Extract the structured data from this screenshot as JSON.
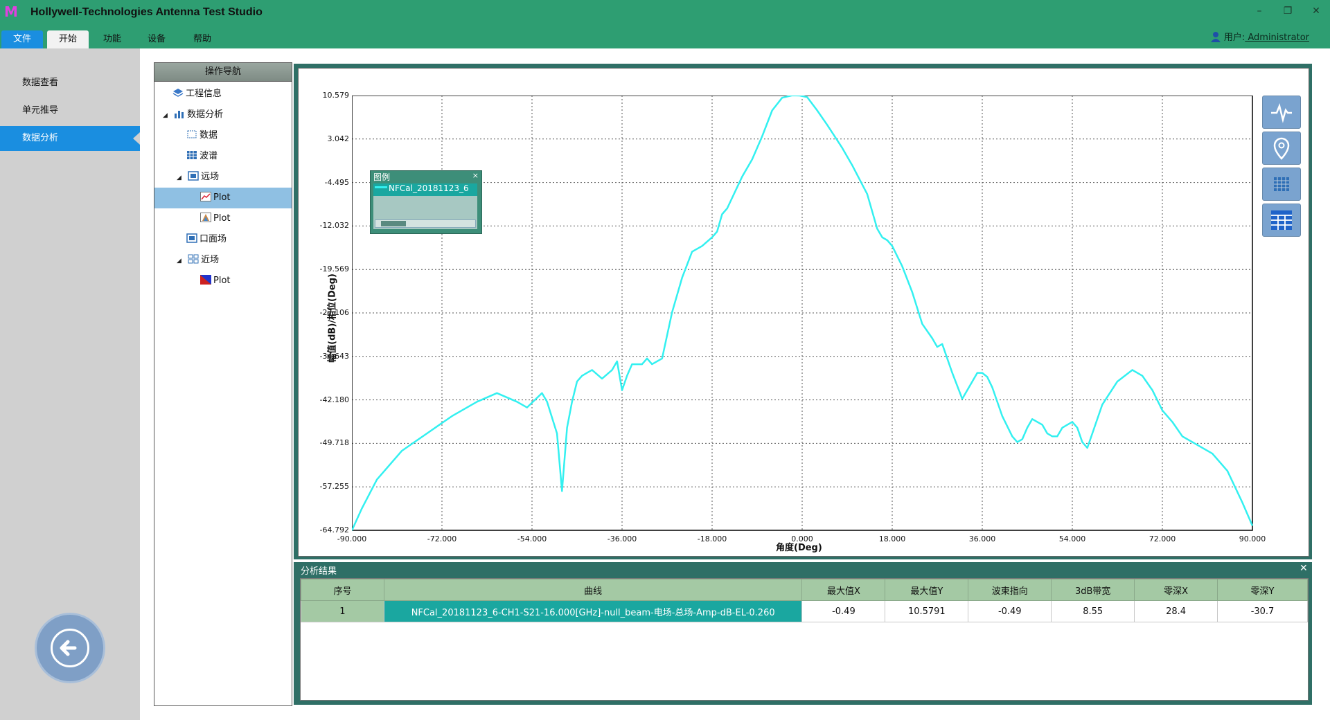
{
  "app": {
    "title": "Hollywell-Technologies Antenna Test Studio",
    "logo_letter": "M"
  },
  "window_controls": {
    "minimize": "–",
    "restore": "❐",
    "close": "✕"
  },
  "menu": {
    "file": "文件",
    "start": "开始",
    "function": "功能",
    "device": "设备",
    "help": "帮助"
  },
  "user": {
    "label": "用户:",
    "name": " Administrator"
  },
  "sidebar": {
    "items": [
      "数据查看",
      "单元推导",
      "数据分析"
    ]
  },
  "nav": {
    "header": "操作导航",
    "nodes": [
      {
        "label": "工程信息"
      },
      {
        "label": "数据分析"
      },
      {
        "label": "数据"
      },
      {
        "label": "波谱"
      },
      {
        "label": "远场"
      },
      {
        "label": "Plot"
      },
      {
        "label": "Plot"
      },
      {
        "label": "口面场"
      },
      {
        "label": "近场"
      },
      {
        "label": "Plot"
      }
    ]
  },
  "legend": {
    "title": "图例",
    "close": "×",
    "entry": "NFCal_20181123_6"
  },
  "chart_data": {
    "type": "line",
    "xlabel": "角度(Deg)",
    "ylabel": "幅值(dB)/相位(Deg)",
    "xlim": [
      -90,
      90
    ],
    "ylim": [
      -64.792,
      10.579
    ],
    "x_ticks": [
      "-90.000",
      "-72.000",
      "-54.000",
      "-36.000",
      "-18.000",
      "0.000",
      "18.000",
      "36.000",
      "54.000",
      "72.000",
      "90.000"
    ],
    "y_ticks": [
      "10.579",
      "3.042",
      "-4.495",
      "-12.032",
      "-19.569",
      "-27.106",
      "-34.643",
      "-42.180",
      "-49.718",
      "-57.255",
      "-64.792"
    ],
    "grid": true,
    "series": [
      {
        "name": "NFCal_20181123_6",
        "color": "#33f0f0",
        "x": [
          -90,
          -88,
          -85,
          -80,
          -75,
          -70,
          -65,
          -61,
          -57,
          -55,
          -52,
          -51,
          -49,
          -48,
          -47,
          -46,
          -45,
          -44,
          -43,
          -42,
          -40,
          -38,
          -37,
          -36,
          -35,
          -34,
          -32,
          -31,
          -30,
          -28,
          -26,
          -24,
          -22,
          -20,
          -18,
          -17,
          -16,
          -15,
          -12,
          -10,
          -8,
          -6,
          -4,
          -2,
          -0.5,
          1,
          3,
          5,
          8,
          10,
          13,
          15,
          16,
          17,
          18,
          20,
          22,
          24,
          26,
          27,
          28,
          30,
          32,
          34,
          35,
          36,
          37,
          38,
          40,
          42,
          43,
          44,
          45,
          46,
          47,
          48,
          49,
          50,
          51,
          52,
          53,
          54,
          55,
          56,
          57,
          58,
          60,
          63,
          66,
          68,
          70,
          72,
          74,
          76,
          78,
          82,
          85,
          88,
          90
        ],
        "y": [
          -64.8,
          -61,
          -56,
          -51,
          -48,
          -45,
          -42.5,
          -41,
          -42.5,
          -43.5,
          -41,
          -42.5,
          -48,
          -58,
          -47,
          -42.5,
          -39,
          -38,
          -37.5,
          -37,
          -38.5,
          -37,
          -35.5,
          -40.5,
          -38,
          -36,
          -36,
          -35,
          -36,
          -35,
          -27,
          -21,
          -16.5,
          -15.5,
          -14,
          -13,
          -10,
          -9,
          -3.5,
          -0.5,
          3.5,
          8,
          10.2,
          10.6,
          10.58,
          10.3,
          8,
          5.5,
          1.5,
          -1.5,
          -6.5,
          -12.5,
          -14,
          -14.5,
          -15.5,
          -19,
          -23.5,
          -29,
          -31.5,
          -33,
          -32.5,
          -37.5,
          -42,
          -39,
          -37.5,
          -37.5,
          -38.2,
          -40,
          -45,
          -48.5,
          -49.5,
          -49,
          -47,
          -45.5,
          -46,
          -46.5,
          -48,
          -48.5,
          -48.5,
          -47,
          -46.5,
          -46,
          -47,
          -49.5,
          -50.5,
          -48,
          -43,
          -39,
          -37,
          -38,
          -40.5,
          -44,
          -46,
          -48.5,
          -49.5,
          -51.5,
          -54.5,
          -60,
          -64
        ]
      }
    ]
  },
  "results": {
    "title": "分析结果",
    "close": "✕",
    "columns": [
      "序号",
      "曲线",
      "最大值X",
      "最大值Y",
      "波束指向",
      "3dB带宽",
      "零深X",
      "零深Y"
    ],
    "rows": [
      [
        "1",
        "NFCal_20181123_6-CH1-S21-16.000[GHz]-null_beam-电场-总场-Amp-dB-EL-0.260",
        "-0.49",
        "10.5791",
        "-0.49",
        "8.55",
        "28.4",
        "-30.7"
      ]
    ]
  },
  "colors": {
    "titlebar": "#2e9e72",
    "accent": "#1a8ee0",
    "curve": "#33f0f0",
    "table_header": "#a4c9a4"
  },
  "tools": [
    "waveform-icon",
    "location-pin-icon",
    "grid-icon",
    "table-icon"
  ]
}
